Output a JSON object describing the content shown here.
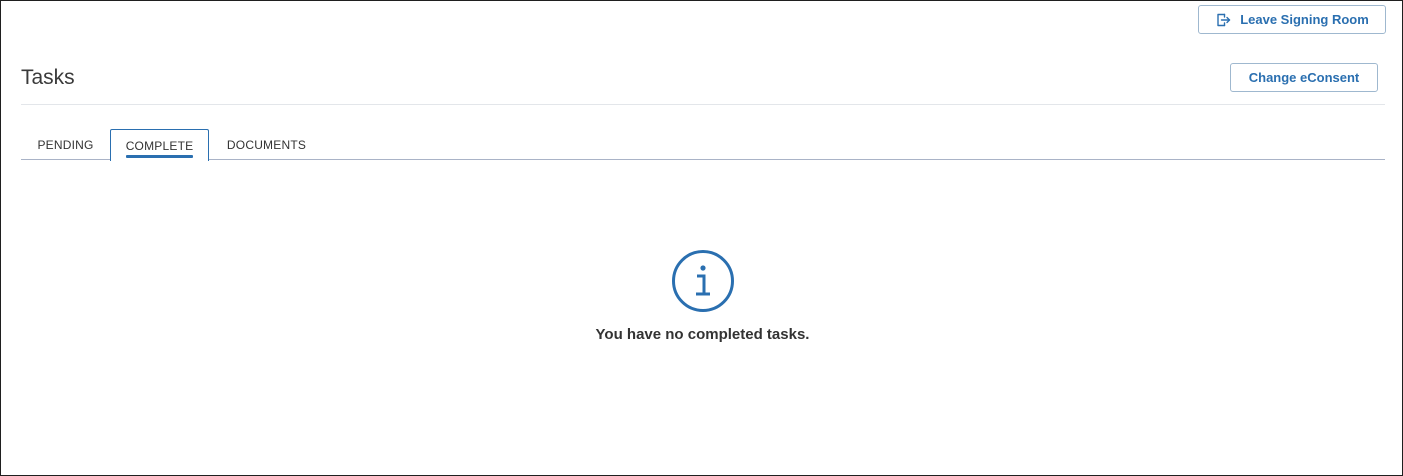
{
  "header": {
    "leave_label": "Leave Signing Room",
    "leave_icon": "exit-icon",
    "title": "Tasks",
    "econsent_label": "Change eConsent"
  },
  "tabs": [
    {
      "label": "PENDING",
      "active": false
    },
    {
      "label": "COMPLETE",
      "active": true
    },
    {
      "label": "DOCUMENTS",
      "active": false
    }
  ],
  "empty_state": {
    "icon": "info-icon",
    "message": "You have no completed tasks."
  },
  "colors": {
    "accent": "#2a6fb0",
    "button_border": "#9fb8cf",
    "tab_line": "#a9b3c7",
    "text": "#333333"
  }
}
